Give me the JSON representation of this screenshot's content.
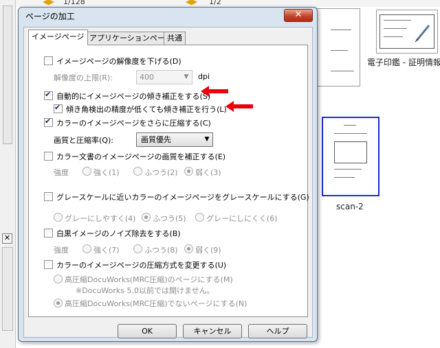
{
  "background": {
    "page_numbers": [
      "1/128",
      "1/2"
    ],
    "thumbnails": [
      {
        "label": "電子印鑑 - 証明情報"
      },
      {
        "label": "scan-2"
      }
    ],
    "close_glyph": "✕"
  },
  "dialog": {
    "title": "ページの加工",
    "close_glyph": "✕",
    "tabs": [
      {
        "label": "イメージページ",
        "active": true
      },
      {
        "label": "アプリケーションページ",
        "active": false
      },
      {
        "label": "共通",
        "active": false
      }
    ],
    "options": {
      "lower_resolution": {
        "label": "イメージページの解像度を下げる(D)",
        "checked": false
      },
      "resolution_limit": {
        "label": "解像度の上限(R):",
        "value": "400",
        "unit": "dpi"
      },
      "auto_deskew": {
        "label": "自動的にイメージページの傾き補正をする(S)",
        "checked": true
      },
      "deskew_low_precision": {
        "label": "傾き角検出の精度が低くても傾き補正を行う(L)",
        "checked": true
      },
      "compress_color": {
        "label": "カラーのイメージページをさらに圧縮する(C)",
        "checked": true
      },
      "quality_ratio": {
        "label": "画質と圧縮率(Q):",
        "value": "画質優先"
      },
      "correct_color_doc": {
        "label": "カラー文書のイメージページの画質を補正する(E)",
        "checked": false
      },
      "strength1": {
        "label": "強度",
        "choices": [
          "強く(1)",
          "ふつう(2)",
          "弱く(3)"
        ],
        "selected": "弱く(3)"
      },
      "grayscale": {
        "label": "グレースケールに近いカラーのイメージページをグレースケールにする(G)",
        "checked": false
      },
      "gray_level": {
        "choices": [
          "グレーにしやすく(4)",
          "ふつう(5)",
          "グレーにしにくく(6)"
        ],
        "selected": "ふつう(5)"
      },
      "bw_noise": {
        "label": "白黒イメージのノイズ除去をする(B)",
        "checked": false
      },
      "strength2": {
        "label": "強度",
        "choices": [
          "強く(7)",
          "ふつう(8)",
          "弱く(9)"
        ],
        "selected": "弱く(9)"
      },
      "change_compression": {
        "label": "カラーのイメージページの圧縮方式を変更する(U)",
        "checked": false
      },
      "mrc_page": {
        "label": "高圧縮DocuWorks(MRC圧縮)のページにする(M)",
        "note": "※DocuWorks 5.0以前では開けません。"
      },
      "non_mrc_page": {
        "label": "高圧縮DocuWorks(MRC圧縮)でないページにする(N)",
        "selected": true
      }
    },
    "buttons": {
      "ok": "OK",
      "cancel": "キャンセル",
      "help": "ヘルプ"
    }
  },
  "colors": {
    "annotation_arrow": "#e8000d",
    "selection_border": "#1a2ecc"
  }
}
